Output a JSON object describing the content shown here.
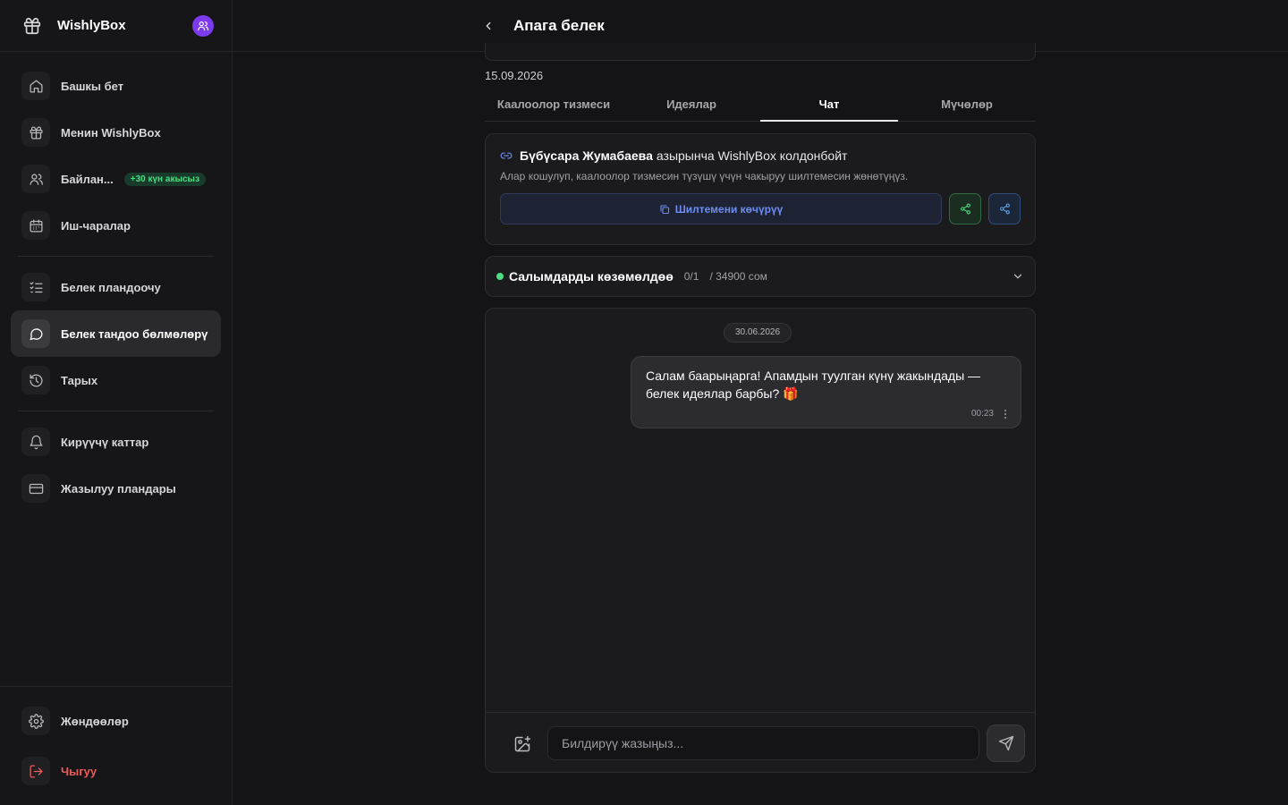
{
  "app": {
    "brand": "WishlyBox"
  },
  "sidebar": {
    "items": [
      {
        "label": "Башкы бет",
        "icon": "home-icon"
      },
      {
        "label": "Менин WishlyBox",
        "icon": "gift-icon"
      },
      {
        "label": "Байлан...",
        "icon": "users-icon",
        "badge": "+30 күн акысыз"
      },
      {
        "label": "Иш-чаралар",
        "icon": "calendar-icon"
      },
      {
        "label": "Белек пландоочу",
        "icon": "list-check-icon"
      },
      {
        "label": "Белек тандоо бөлмөлөрү",
        "icon": "chat-bubble-icon",
        "active": true
      },
      {
        "label": "Тарых",
        "icon": "history-icon"
      },
      {
        "label": "Кирүүчү каттар",
        "icon": "bell-icon"
      },
      {
        "label": "Жазылуу пландары",
        "icon": "credit-card-icon"
      }
    ],
    "bottom": [
      {
        "label": "Жөндөөлөр",
        "icon": "gear-icon"
      },
      {
        "label": "Чыгуу",
        "icon": "logout-icon"
      }
    ]
  },
  "header": {
    "title": "Апага белек"
  },
  "event": {
    "date": "15.09.2026"
  },
  "tabs": [
    {
      "label": "Каалоолор тизмеси",
      "active": false
    },
    {
      "label": "Идеялар",
      "active": false
    },
    {
      "label": "Чат",
      "active": true
    },
    {
      "label": "Мүчөлөр",
      "active": false
    }
  ],
  "invite": {
    "name": "Бүбүсара Жумабаева",
    "status_text": "азырынча WishlyBox колдонбойт",
    "description": "Алар кошулуп, каалоолор тизмесин түзүшү үчүн чакыруу шилтемесин жөнөтүңүз.",
    "copy_label": "Шилтемени көчүрүү"
  },
  "budget": {
    "title": "Салымдарды көзөмөлдөө",
    "count": "0/1",
    "sum": "/ 34900 сом"
  },
  "chat": {
    "date_chip": "30.06.2026",
    "messages": [
      {
        "text": "Салам баарыңарга! Апамдын туулган күнү жакындады — белек идеялар барбы? 🎁",
        "time": "00:23"
      }
    ],
    "input_placeholder": "Билдирүү жазыңыз..."
  },
  "colors": {
    "accent_purple": "#7c3aed",
    "badge_green": "#4ade80",
    "link_blue": "#6e8cf0",
    "danger": "#ef5a5a"
  }
}
